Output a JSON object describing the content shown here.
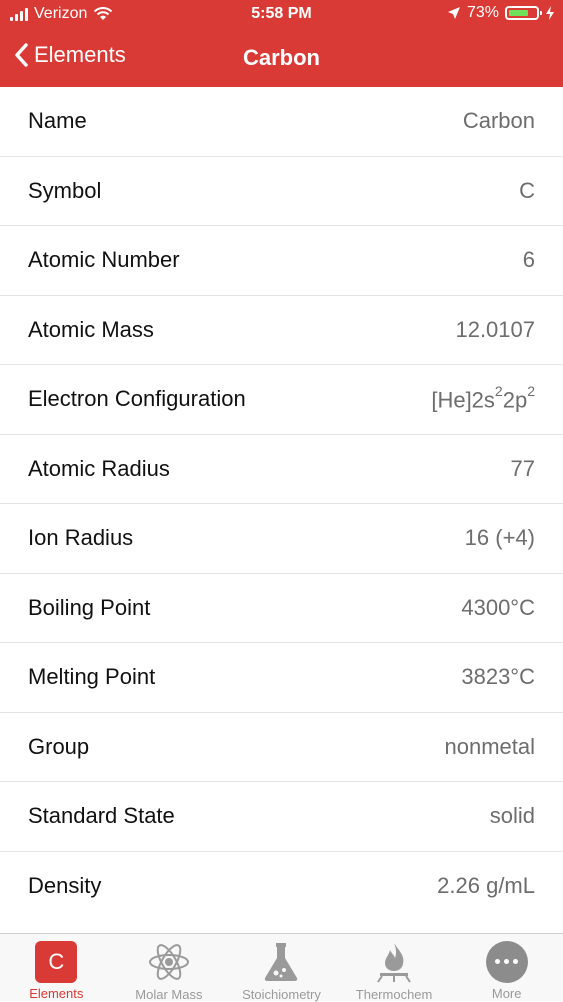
{
  "status_bar": {
    "carrier": "Verizon",
    "time": "5:58 PM",
    "battery": "73%",
    "battery_fraction": 0.73
  },
  "nav": {
    "back_label": "Elements",
    "title": "Carbon"
  },
  "rows": [
    {
      "label": "Name",
      "value": "Carbon"
    },
    {
      "label": "Symbol",
      "value": "C"
    },
    {
      "label": "Atomic Number",
      "value": "6"
    },
    {
      "label": "Atomic Mass",
      "value": "12.0107"
    },
    {
      "label": "Electron Configuration",
      "value_base": "[He]2s",
      "value_sup1": "2",
      "value_mid": "2p",
      "value_sup2": "2"
    },
    {
      "label": "Atomic Radius",
      "value": "77"
    },
    {
      "label": "Ion Radius",
      "value": "16 (+4)"
    },
    {
      "label": "Boiling Point",
      "value": "4300°C"
    },
    {
      "label": "Melting Point",
      "value": "3823°C"
    },
    {
      "label": "Group",
      "value": "nonmetal"
    },
    {
      "label": "Standard State",
      "value": "solid"
    },
    {
      "label": "Density",
      "value": "2.26 g/mL"
    }
  ],
  "tabs": [
    {
      "label": "Elements",
      "icon": "element-c-icon",
      "glyph": "C",
      "active": true
    },
    {
      "label": "Molar Mass",
      "icon": "atom-icon"
    },
    {
      "label": "Stoichiometry",
      "icon": "flask-icon"
    },
    {
      "label": "Thermochem",
      "icon": "burner-flame-icon"
    },
    {
      "label": "More",
      "icon": "more-dots-icon"
    }
  ],
  "colors": {
    "accent": "#d93a35",
    "battery": "#6ee05a"
  }
}
